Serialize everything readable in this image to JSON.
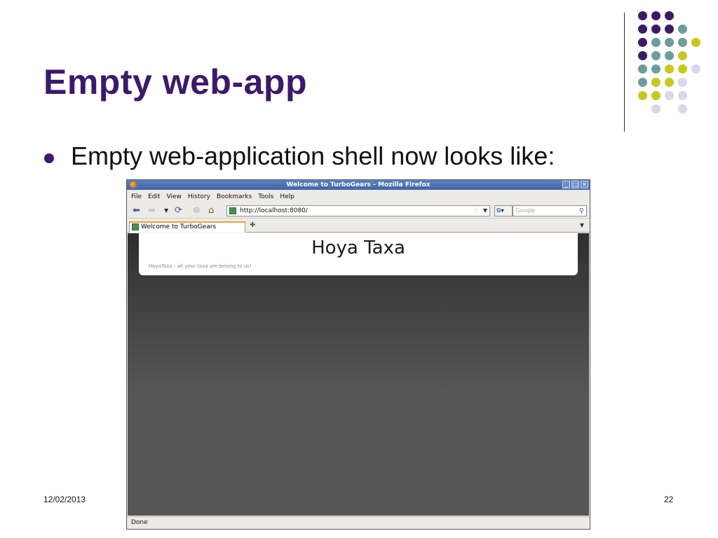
{
  "slide": {
    "title": "Empty web-app",
    "bullet": "Empty web-application shell now looks like:",
    "date": "12/02/2013",
    "page_number": "22"
  },
  "colors": {
    "title": "#3b1a6b",
    "purple": "#3b1a6b",
    "teal": "#6d9c9c",
    "olive": "#c8c81e",
    "lavender": "#d8d8ea"
  },
  "decoration_dot_grid": [
    [
      "purple",
      "purple",
      "purple",
      null,
      null
    ],
    [
      "purple",
      "purple",
      "purple",
      "teal",
      null
    ],
    [
      "purple",
      "teal",
      "teal",
      "teal",
      "olive"
    ],
    [
      "purple",
      "teal",
      "teal",
      "olive",
      null
    ],
    [
      "teal",
      "teal",
      "olive",
      "olive",
      "lavender"
    ],
    [
      "teal",
      "olive",
      "olive",
      "lavender",
      null
    ],
    [
      "olive",
      "olive",
      "lavender",
      "lavender",
      null
    ],
    [
      null,
      "lavender",
      null,
      "lavender",
      null
    ]
  ],
  "browser": {
    "window_title": "Welcome to TurboGears - Mozilla Firefox",
    "menu": [
      "File",
      "Edit",
      "View",
      "History",
      "Bookmarks",
      "Tools",
      "Help"
    ],
    "url": "http://localhost:8080/",
    "search_placeholder": "Google",
    "tab_title": "Welcome to TurboGears",
    "status": "Done",
    "icons": {
      "back": "arrow-left-icon",
      "forward": "arrow-right-icon",
      "reload": "reload-icon",
      "stop": "stop-icon",
      "home": "home-icon"
    }
  },
  "page": {
    "title": "Hoya Taxa",
    "subtitle": "HoyaTaxa - all your taxa are belong to us!"
  }
}
